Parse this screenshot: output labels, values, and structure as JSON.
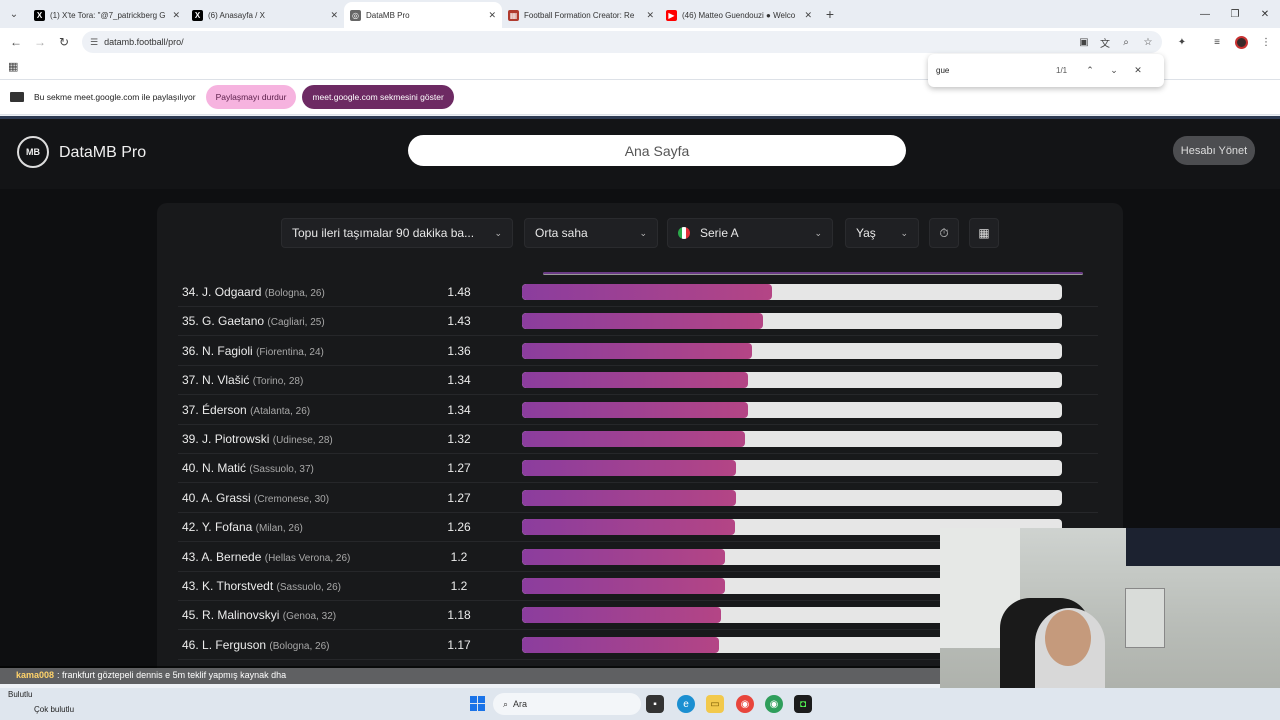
{
  "browser": {
    "tabs": [
      {
        "title": "(1) X'te Tora: \"@7_patrickberg G",
        "favicon": "X",
        "color": "#000000",
        "active": false
      },
      {
        "title": "(6) Anasayfa / X",
        "favicon": "X",
        "color": "#000000",
        "active": false
      },
      {
        "title": "DataMB Pro",
        "favicon": "◎",
        "color": "#666666",
        "active": true
      },
      {
        "title": "Football Formation Creator: Re",
        "favicon": "▦",
        "color": "#b03a2e",
        "active": false
      },
      {
        "title": "(46) Matteo Guendouzi ● Welco",
        "favicon": "▶",
        "color": "#ff0000",
        "active": false
      }
    ],
    "url": "datamb.football/pro/",
    "find": {
      "query": "gue",
      "count": "1/1"
    },
    "share_bar": {
      "text": "Bu sekme meet.google.com ile paylaşılıyor",
      "stop_label": "Paylaşmayı durdur",
      "show_label": "meet.google.com sekmesini göster"
    }
  },
  "app": {
    "logo_mark": "MB",
    "brand": "DataMB Pro",
    "search_placeholder": "Ana Sayfa",
    "account_button": "Hesabı Yönet",
    "filters": {
      "metric": "Topu ileri taşımalar 90 dakika ba...",
      "position": "Orta saha",
      "league": "Serie A",
      "age": "Yaş"
    },
    "bar_scale_max": 3.2,
    "rows": [
      {
        "rank": "34.",
        "name": "J. Odgaard",
        "club": "(Bologna, 26)",
        "value": 1.48
      },
      {
        "rank": "35.",
        "name": "G. Gaetano",
        "club": "(Cagliari, 25)",
        "value": 1.43
      },
      {
        "rank": "36.",
        "name": "N. Fagioli",
        "club": "(Fiorentina, 24)",
        "value": 1.36
      },
      {
        "rank": "37.",
        "name": "N. Vlašić",
        "club": "(Torino, 28)",
        "value": 1.34
      },
      {
        "rank": "37.",
        "name": "Éderson",
        "club": "(Atalanta, 26)",
        "value": 1.34
      },
      {
        "rank": "39.",
        "name": "J. Piotrowski",
        "club": "(Udinese, 28)",
        "value": 1.32
      },
      {
        "rank": "40.",
        "name": "N. Matić",
        "club": "(Sassuolo, 37)",
        "value": 1.27
      },
      {
        "rank": "40.",
        "name": "A. Grassi",
        "club": "(Cremonese, 30)",
        "value": 1.27
      },
      {
        "rank": "42.",
        "name": "Y. Fofana",
        "club": "(Milan, 26)",
        "value": 1.26
      },
      {
        "rank": "43.",
        "name": "A. Bernede",
        "club": "(Hellas Verona, 26)",
        "value": 1.2
      },
      {
        "rank": "43.",
        "name": "K. Thorstvedt",
        "club": "(Sassuolo, 26)",
        "value": 1.2
      },
      {
        "rank": "45.",
        "name": "R. Malinovskyi",
        "club": "(Genoa, 32)",
        "value": 1.18
      },
      {
        "rank": "46.",
        "name": "L. Ferguson",
        "club": "(Bologna, 26)",
        "value": 1.17
      }
    ]
  },
  "chat": {
    "user": "kama008",
    "message": ": frankfurt göztepeli dennis e 5m teklif yapmış kaynak dha"
  },
  "taskbar": {
    "weather_line1": "Bulutlu",
    "weather_line2": "Çok bulutlu",
    "search_label": "Ara"
  }
}
